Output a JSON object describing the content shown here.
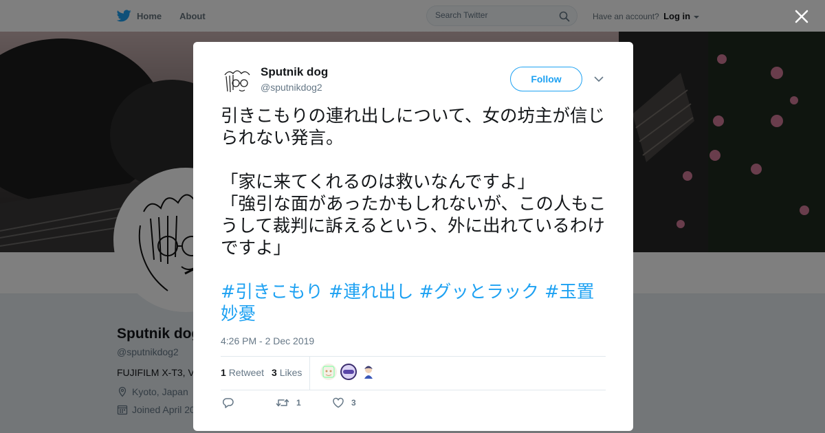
{
  "topbar": {
    "home_label": "Home",
    "about_label": "About",
    "search_placeholder": "Search Twitter",
    "account_prompt": "Have an account?",
    "login_label": "Log in"
  },
  "profile": {
    "name": "Sputnik dog",
    "handle": "@sputnikdog2",
    "bio": "FUJIFILM X-T3, V",
    "location": "Kyoto, Japan",
    "joined": "Joined April 20"
  },
  "tweet": {
    "author_name": "Sputnik dog",
    "author_handle": "@sputnikdog2",
    "follow_label": "Follow",
    "text": "引きこもりの連れ出しについて、女の坊主が信じられない発言。\n\n「家に来てくれるのは救いなんですよ」\n「強引な面があったかもしれないが、この人もこうして裁判に訴えるという、外に出れているわけですよ」",
    "hashtags": [
      "#引きこもり",
      "#連れ出し",
      "#グッとラック",
      "#玉置妙憂"
    ],
    "timestamp": "4:26 PM - 2 Dec 2019",
    "retweet_count": "1",
    "retweet_label": "Retweet",
    "like_count": "3",
    "like_label": "Likes",
    "action_retweet_count": "1",
    "action_like_count": "3"
  },
  "colors": {
    "accent": "#1da1f2",
    "secondary_text": "#657786",
    "border": "#e1e8ed"
  }
}
